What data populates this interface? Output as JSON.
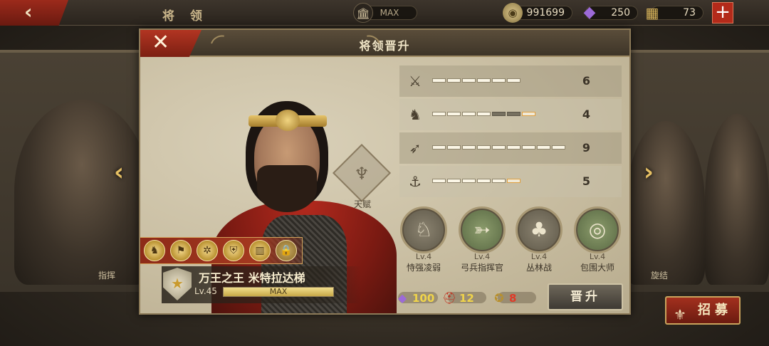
{
  "topbar": {
    "back_icon": "back-arrow-icon",
    "title": "将 领",
    "building_level": "MAX",
    "coins": "991699",
    "gems": "250",
    "rations": "73",
    "add_icon": "plus-icon"
  },
  "background": {
    "left_hero_label": "指挥",
    "right_hero_label": "旋结"
  },
  "recruit_button": {
    "label": "招募"
  },
  "modal": {
    "title": "将领晋升",
    "close_icon": "close-icon",
    "talent_label": "天赋",
    "hero": {
      "name": "万王之王 米特拉达梯",
      "level": "Lv.45",
      "level_bar_text": "MAX",
      "level_progress": 1.0
    },
    "skill_chip_icons": [
      "horse-head-icon",
      "banner-icon",
      "wheel-icon",
      "shield-emblem-icon",
      "gate-icon",
      "lock-icon"
    ],
    "stats": [
      {
        "icon": "sword-icon",
        "value": "6",
        "filled": 6,
        "dark": 0,
        "highlight": 0
      },
      {
        "icon": "horse-icon",
        "value": "4",
        "filled": 4,
        "dark": 2,
        "highlight": 1
      },
      {
        "icon": "bow-icon",
        "value": "9",
        "filled": 9,
        "dark": 0,
        "highlight": 0
      },
      {
        "icon": "anchor-icon",
        "value": "5",
        "filled": 5,
        "dark": 0,
        "highlight": 1
      }
    ],
    "upgrades": [
      {
        "icon": "cavalry-icon",
        "level": "Lv.4",
        "name": "恃强凌弱"
      },
      {
        "icon": "bow-icon",
        "level": "Lv.4",
        "name": "弓兵指挥官"
      },
      {
        "icon": "forest-icon",
        "level": "Lv.4",
        "name": "丛林战"
      },
      {
        "icon": "encircle-icon",
        "level": "Lv.4",
        "name": "包围大师"
      }
    ],
    "costs": [
      {
        "icon": "gem-icon",
        "value": "100",
        "color": "#f0d44a"
      },
      {
        "icon": "helmet-icon",
        "value": "12",
        "color": "#f0d44a"
      },
      {
        "icon": "medal-icon",
        "value": "8",
        "color": "#e03a28"
      }
    ],
    "promote_button": "晋升"
  }
}
